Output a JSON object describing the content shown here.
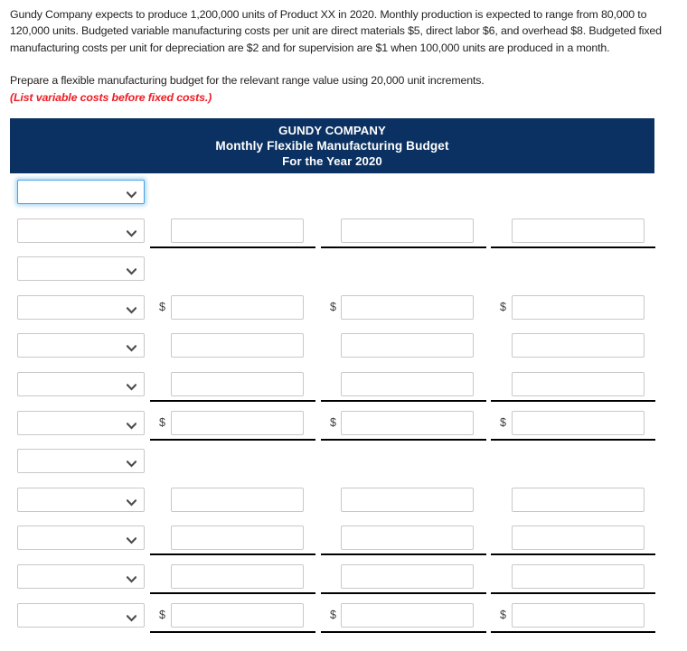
{
  "problem": {
    "paragraph_1": "Gundy Company expects to produce 1,200,000 units of Product XX in 2020. Monthly production is expected to range from 80,000 to 120,000 units. Budgeted variable manufacturing costs per unit are direct materials $5, direct labor $6, and overhead $8. Budgeted fixed manufacturing costs per unit for depreciation are $2 and for supervision are $1 when 100,000 units are produced in a month.",
    "instruction": "Prepare a flexible manufacturing budget for the relevant range value using 20,000 unit increments. ",
    "hint": "(List variable costs before fixed costs.)"
  },
  "banner": {
    "company": "GUNDY COMPANY",
    "report_title": "Monthly Flexible Manufacturing Budget",
    "period": "For the Year 2020",
    "background_color": "#0a3161",
    "text_color": "#ffffff"
  },
  "colors": {
    "accent_red": "#ed1c24",
    "focus_blue": "#4ba3e3",
    "field_border": "#c8c8c8",
    "rule_black": "#000000"
  },
  "worksheet": {
    "select_placeholder": "",
    "amount_placeholder": "",
    "dollar_symbol": "$",
    "select_options": [
      ""
    ],
    "rows": [
      {
        "id": "row-1",
        "label_value": "",
        "focused": true,
        "cells": [
          {
            "column": 1,
            "value": "",
            "visible": false,
            "dollar": false,
            "rule": false
          },
          {
            "column": 2,
            "value": "",
            "visible": false,
            "dollar": false,
            "rule": false
          },
          {
            "column": 3,
            "value": "",
            "visible": false,
            "dollar": false,
            "rule": false
          }
        ]
      },
      {
        "id": "row-2",
        "label_value": "",
        "focused": false,
        "cells": [
          {
            "column": 1,
            "value": "",
            "visible": true,
            "dollar": false,
            "rule": true
          },
          {
            "column": 2,
            "value": "",
            "visible": true,
            "dollar": false,
            "rule": true
          },
          {
            "column": 3,
            "value": "",
            "visible": true,
            "dollar": false,
            "rule": true
          }
        ]
      },
      {
        "id": "row-3",
        "label_value": "",
        "focused": false,
        "cells": [
          {
            "column": 1,
            "value": "",
            "visible": false,
            "dollar": false,
            "rule": false
          },
          {
            "column": 2,
            "value": "",
            "visible": false,
            "dollar": false,
            "rule": false
          },
          {
            "column": 3,
            "value": "",
            "visible": false,
            "dollar": false,
            "rule": false
          }
        ]
      },
      {
        "id": "row-4",
        "label_value": "",
        "focused": false,
        "cells": [
          {
            "column": 1,
            "value": "",
            "visible": true,
            "dollar": true,
            "rule": false
          },
          {
            "column": 2,
            "value": "",
            "visible": true,
            "dollar": true,
            "rule": false
          },
          {
            "column": 3,
            "value": "",
            "visible": true,
            "dollar": true,
            "rule": false
          }
        ]
      },
      {
        "id": "row-5",
        "label_value": "",
        "focused": false,
        "cells": [
          {
            "column": 1,
            "value": "",
            "visible": true,
            "dollar": false,
            "rule": false
          },
          {
            "column": 2,
            "value": "",
            "visible": true,
            "dollar": false,
            "rule": false
          },
          {
            "column": 3,
            "value": "",
            "visible": true,
            "dollar": false,
            "rule": false
          }
        ]
      },
      {
        "id": "row-6",
        "label_value": "",
        "focused": false,
        "cells": [
          {
            "column": 1,
            "value": "",
            "visible": true,
            "dollar": false,
            "rule": true
          },
          {
            "column": 2,
            "value": "",
            "visible": true,
            "dollar": false,
            "rule": true
          },
          {
            "column": 3,
            "value": "",
            "visible": true,
            "dollar": false,
            "rule": true
          }
        ]
      },
      {
        "id": "row-7",
        "label_value": "",
        "focused": false,
        "cells": [
          {
            "column": 1,
            "value": "",
            "visible": true,
            "dollar": true,
            "rule": true
          },
          {
            "column": 2,
            "value": "",
            "visible": true,
            "dollar": true,
            "rule": true
          },
          {
            "column": 3,
            "value": "",
            "visible": true,
            "dollar": true,
            "rule": true
          }
        ]
      },
      {
        "id": "row-8",
        "label_value": "",
        "focused": false,
        "cells": [
          {
            "column": 1,
            "value": "",
            "visible": false,
            "dollar": false,
            "rule": false
          },
          {
            "column": 2,
            "value": "",
            "visible": false,
            "dollar": false,
            "rule": false
          },
          {
            "column": 3,
            "value": "",
            "visible": false,
            "dollar": false,
            "rule": false
          }
        ]
      },
      {
        "id": "row-9",
        "label_value": "",
        "focused": false,
        "cells": [
          {
            "column": 1,
            "value": "",
            "visible": true,
            "dollar": false,
            "rule": false
          },
          {
            "column": 2,
            "value": "",
            "visible": true,
            "dollar": false,
            "rule": false
          },
          {
            "column": 3,
            "value": "",
            "visible": true,
            "dollar": false,
            "rule": false
          }
        ]
      },
      {
        "id": "row-10",
        "label_value": "",
        "focused": false,
        "cells": [
          {
            "column": 1,
            "value": "",
            "visible": true,
            "dollar": false,
            "rule": true
          },
          {
            "column": 2,
            "value": "",
            "visible": true,
            "dollar": false,
            "rule": true
          },
          {
            "column": 3,
            "value": "",
            "visible": true,
            "dollar": false,
            "rule": true
          }
        ]
      },
      {
        "id": "row-11",
        "label_value": "",
        "focused": false,
        "cells": [
          {
            "column": 1,
            "value": "",
            "visible": true,
            "dollar": false,
            "rule": true
          },
          {
            "column": 2,
            "value": "",
            "visible": true,
            "dollar": false,
            "rule": true
          },
          {
            "column": 3,
            "value": "",
            "visible": true,
            "dollar": false,
            "rule": true
          }
        ]
      },
      {
        "id": "row-12",
        "label_value": "",
        "focused": false,
        "cells": [
          {
            "column": 1,
            "value": "",
            "visible": true,
            "dollar": true,
            "rule": true
          },
          {
            "column": 2,
            "value": "",
            "visible": true,
            "dollar": true,
            "rule": true
          },
          {
            "column": 3,
            "value": "",
            "visible": true,
            "dollar": true,
            "rule": true
          }
        ]
      }
    ]
  }
}
